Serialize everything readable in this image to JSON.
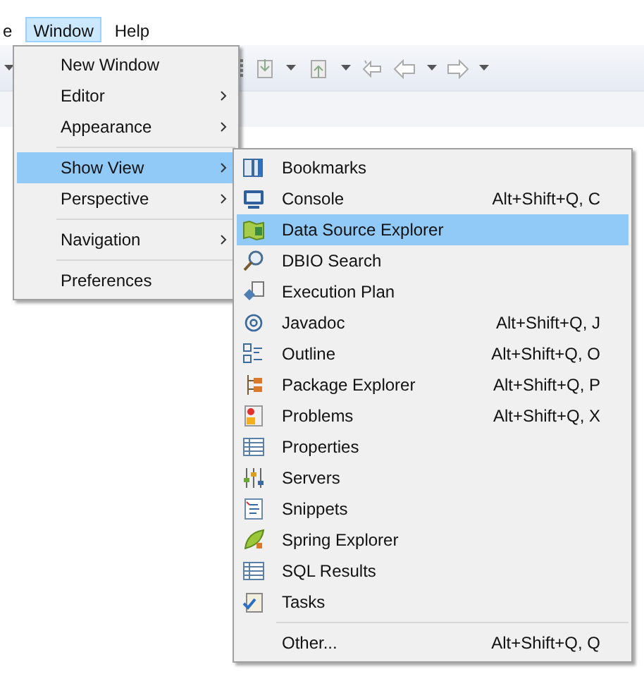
{
  "menu_bar": [
    {
      "label": "e",
      "selected": false
    },
    {
      "label": "Window",
      "selected": true
    },
    {
      "label": "Help",
      "selected": false
    }
  ],
  "window_menu": [
    {
      "kind": "item",
      "label": "New Window",
      "submenu": false,
      "selected": false
    },
    {
      "kind": "item",
      "label": "Editor",
      "submenu": true,
      "selected": false
    },
    {
      "kind": "item",
      "label": "Appearance",
      "submenu": true,
      "selected": false
    },
    {
      "kind": "separator"
    },
    {
      "kind": "item",
      "label": "Show View",
      "submenu": true,
      "selected": true
    },
    {
      "kind": "item",
      "label": "Perspective",
      "submenu": true,
      "selected": false
    },
    {
      "kind": "separator"
    },
    {
      "kind": "item",
      "label": "Navigation",
      "submenu": true,
      "selected": false
    },
    {
      "kind": "separator"
    },
    {
      "kind": "item",
      "label": "Preferences",
      "submenu": false,
      "selected": false
    }
  ],
  "show_view_menu": [
    {
      "kind": "item",
      "label": "Bookmarks",
      "selected": false
    },
    {
      "kind": "item",
      "label": "Console",
      "shortcut": "Alt+Shift+Q, C",
      "selected": false
    },
    {
      "kind": "item",
      "label": "Data Source Explorer",
      "selected": true
    },
    {
      "kind": "item",
      "label": "DBIO Search",
      "selected": false
    },
    {
      "kind": "item",
      "label": "Execution Plan",
      "selected": false
    },
    {
      "kind": "item",
      "label": "Javadoc",
      "shortcut": "Alt+Shift+Q, J",
      "selected": false
    },
    {
      "kind": "item",
      "label": "Outline",
      "shortcut": "Alt+Shift+Q, O",
      "selected": false
    },
    {
      "kind": "item",
      "label": "Package Explorer",
      "shortcut": "Alt+Shift+Q, P",
      "selected": false
    },
    {
      "kind": "item",
      "label": "Problems",
      "shortcut": "Alt+Shift+Q, X",
      "selected": false
    },
    {
      "kind": "item",
      "label": "Properties",
      "selected": false
    },
    {
      "kind": "item",
      "label": "Servers",
      "selected": false
    },
    {
      "kind": "item",
      "label": "Snippets",
      "selected": false
    },
    {
      "kind": "item",
      "label": "Spring Explorer",
      "selected": false
    },
    {
      "kind": "item",
      "label": "SQL Results",
      "selected": false
    },
    {
      "kind": "item",
      "label": "Tasks",
      "selected": false
    },
    {
      "kind": "separator"
    },
    {
      "kind": "item",
      "label": "Other...",
      "shortcut": "Alt+Shift+Q, Q",
      "selected": false
    }
  ]
}
